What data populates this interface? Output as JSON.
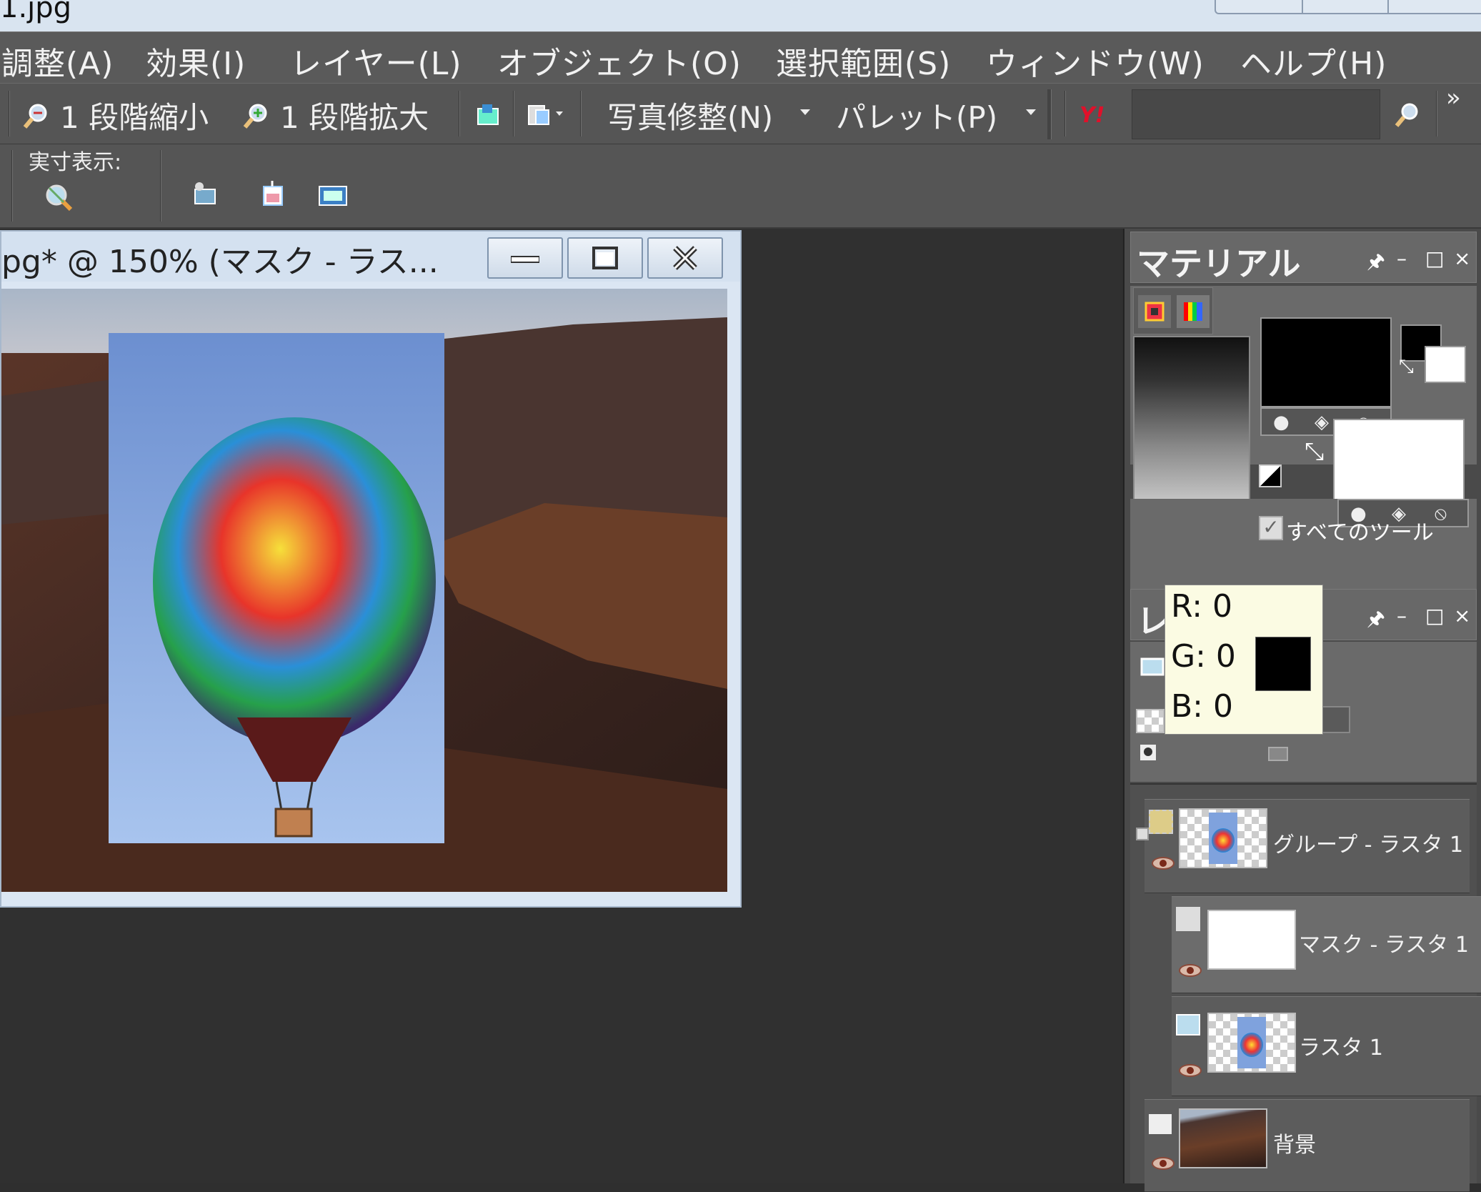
{
  "window": {
    "title_fragment": "1.jpg"
  },
  "menu": {
    "items": [
      "調整(A)",
      "効果(I)",
      "レイヤー(L)",
      "オブジェクト(O)",
      "選択範囲(S)",
      "ウィンドウ(W)",
      "ヘルプ(H)"
    ]
  },
  "toolbar": {
    "zoom_out_label": "1 段階縮小",
    "zoom_in_label": "1 段階拡大",
    "photo_fix_label": "写真修整(N)",
    "palette_label": "パレット(P)",
    "search_value": "",
    "overflow": "»",
    "actual_size_label": "実寸表示:"
  },
  "document": {
    "title": "pg* @ 150% (マスク - ラス..."
  },
  "materials": {
    "title": "マテリアル",
    "all_tools_label": "すべてのツール",
    "all_tools_checked": true,
    "foreground_color": "#000000",
    "background_color": "#ffffff"
  },
  "layers": {
    "title_fragment": "レ",
    "items": [
      {
        "name": "グループ - ラスタ 1"
      },
      {
        "name": "マスク - ラスタ 1"
      },
      {
        "name": "ラスタ 1"
      },
      {
        "name": "背景"
      }
    ]
  },
  "tooltip": {
    "r": "R: 0",
    "g": "G: 0",
    "b": "B: 0",
    "swatch": "#000000"
  },
  "colors": {
    "menu_bg": "#5a5a5a",
    "panel_bg": "#4a4a4a",
    "workspace_bg": "#303030",
    "doc_frame": "#dbe6f3"
  }
}
